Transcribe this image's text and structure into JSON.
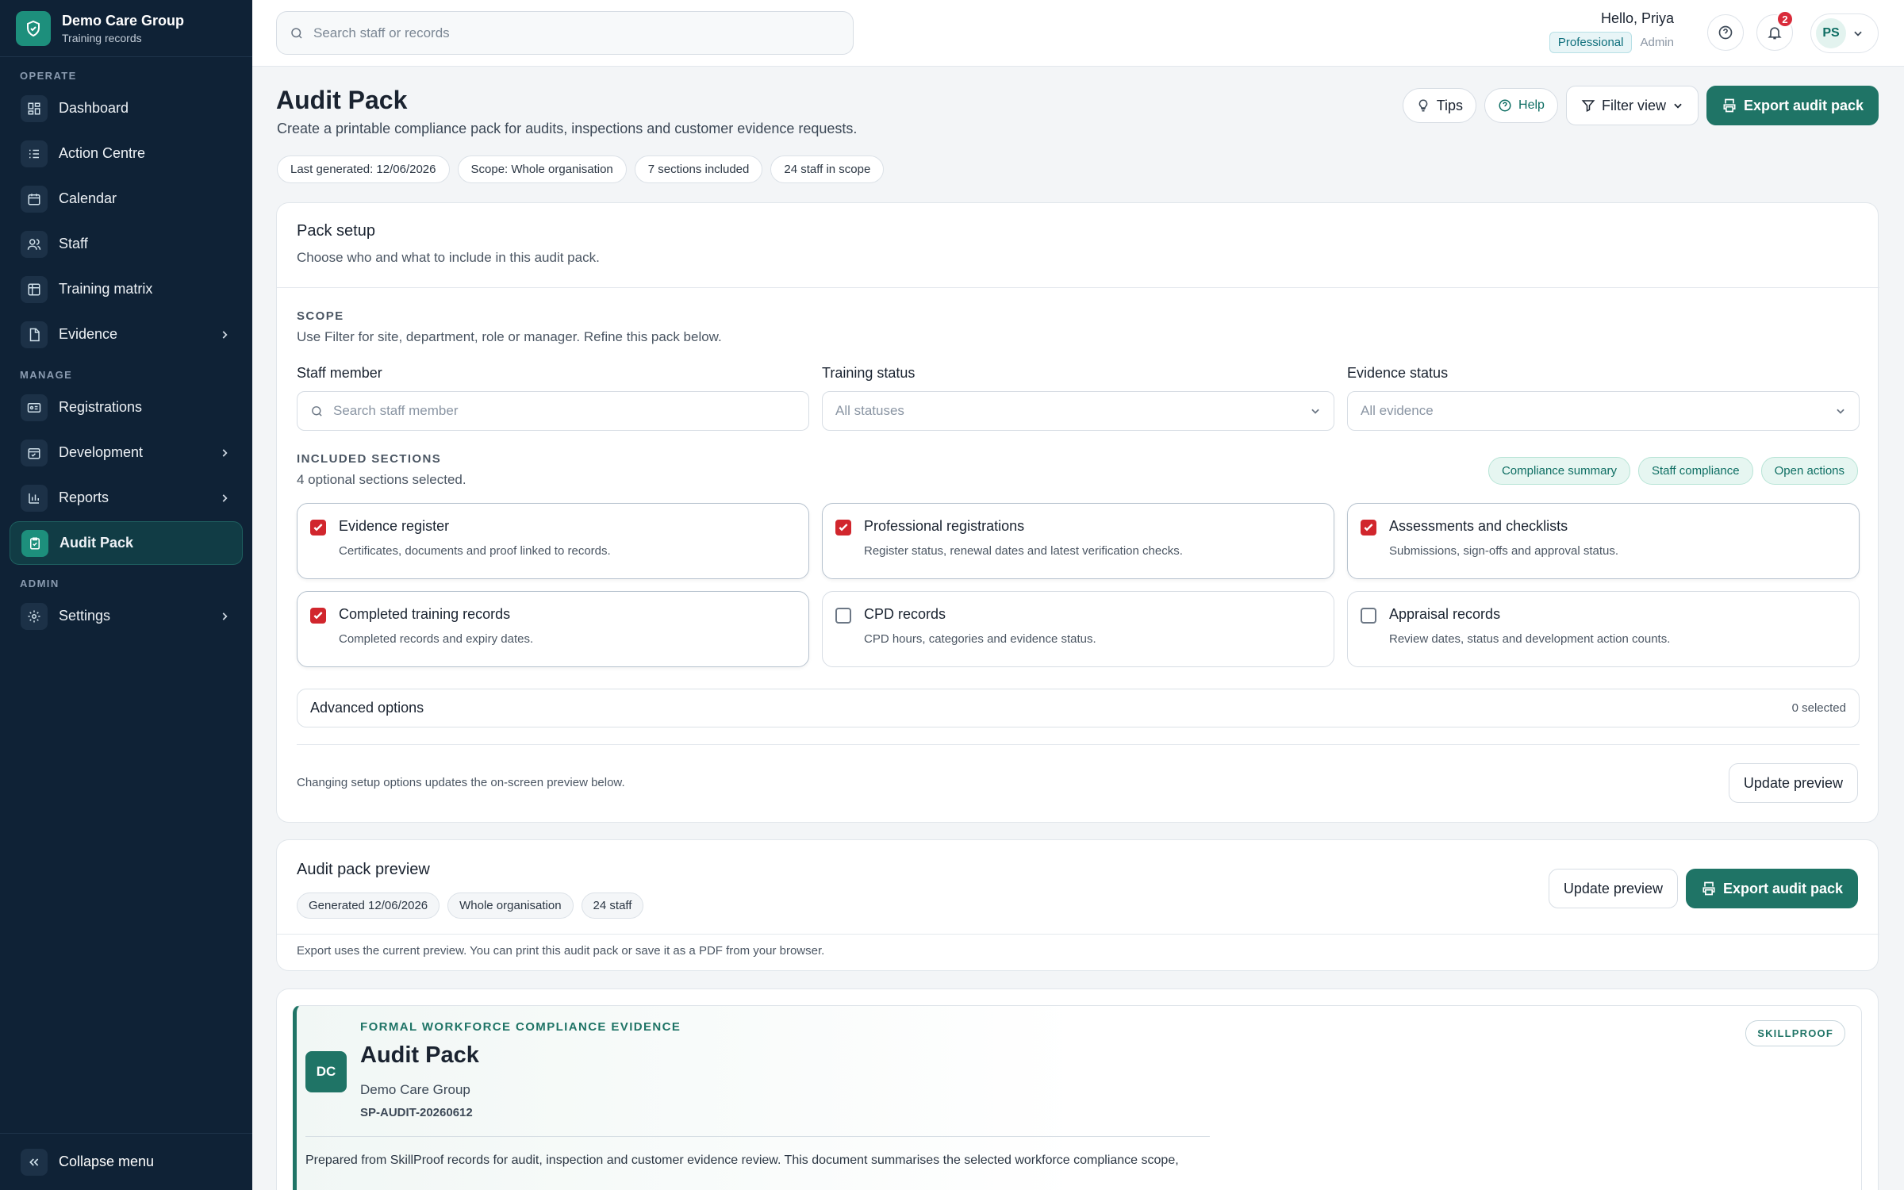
{
  "brand": {
    "name": "Demo Care Group",
    "sub": "Training records"
  },
  "nav": {
    "operate_label": "OPERATE",
    "manage_label": "MANAGE",
    "admin_label": "ADMIN",
    "dashboard": "Dashboard",
    "action_centre": "Action Centre",
    "calendar": "Calendar",
    "staff": "Staff",
    "training_matrix": "Training matrix",
    "evidence": "Evidence",
    "registrations": "Registrations",
    "development": "Development",
    "reports": "Reports",
    "audit_pack": "Audit Pack",
    "settings": "Settings",
    "collapse": "Collapse menu"
  },
  "topbar": {
    "search_placeholder": "Search staff or records",
    "greeting": "Hello, Priya",
    "plan": "Professional",
    "role": "Admin",
    "notification_count": "2",
    "avatar_initials": "PS"
  },
  "page": {
    "title": "Audit Pack",
    "subtitle": "Create a printable compliance pack for audits, inspections and customer evidence requests.",
    "chips": [
      "Last generated: 12/06/2026",
      "Scope: Whole organisation",
      "7 sections included",
      "24 staff in scope"
    ],
    "tips": "Tips",
    "help": "Help",
    "filter_view": "Filter view",
    "export": "Export audit pack"
  },
  "setup": {
    "title": "Pack setup",
    "subtitle": "Choose who and what to include in this audit pack.",
    "scope_label": "SCOPE",
    "scope_hint": "Use Filter for site, department, role or manager. Refine this pack below.",
    "staff_label": "Staff member",
    "staff_placeholder": "Search staff member",
    "training_label": "Training status",
    "training_value": "All statuses",
    "evidence_label": "Evidence status",
    "evidence_value": "All evidence",
    "sections_label": "INCLUDED SECTIONS",
    "sections_count": "4 optional sections selected.",
    "fixed_tags": [
      "Compliance summary",
      "Staff compliance",
      "Open actions"
    ],
    "options": [
      {
        "title": "Evidence register",
        "desc": "Certificates, documents and proof linked to records.",
        "checked": true
      },
      {
        "title": "Professional registrations",
        "desc": "Register status, renewal dates and latest verification checks.",
        "checked": true
      },
      {
        "title": "Assessments and checklists",
        "desc": "Submissions, sign-offs and approval status.",
        "checked": true
      },
      {
        "title": "Completed training records",
        "desc": "Completed records and expiry dates.",
        "checked": true
      },
      {
        "title": "CPD records",
        "desc": "CPD hours, categories and evidence status.",
        "checked": false
      },
      {
        "title": "Appraisal records",
        "desc": "Review dates, status and development action counts.",
        "checked": false
      }
    ],
    "advanced_label": "Advanced options",
    "advanced_count": "0 selected",
    "footer_note": "Changing setup options updates the on-screen preview below.",
    "update_preview": "Update preview"
  },
  "preview": {
    "title": "Audit pack preview",
    "chips": [
      "Generated 12/06/2026",
      "Whole organisation",
      "24 staff"
    ],
    "update_preview": "Update preview",
    "export": "Export audit pack",
    "note": "Export uses the current preview. You can print this audit pack or save it as a PDF from your browser."
  },
  "document": {
    "eyebrow": "FORMAL WORKFORCE COMPLIANCE EVIDENCE",
    "title": "Audit Pack",
    "org": "Demo Care Group",
    "ref": "SP-AUDIT-20260612",
    "logo_initials": "DC",
    "brand_badge": "SKILLPROOF",
    "intro": "Prepared from SkillProof records for audit, inspection and customer evidence review. This document summarises the selected workforce compliance scope,"
  },
  "colors": {
    "sidebar": "#0f2236",
    "accent": "#1f7466",
    "checkbox": "#d1262d",
    "notification": "#d92b3a"
  }
}
